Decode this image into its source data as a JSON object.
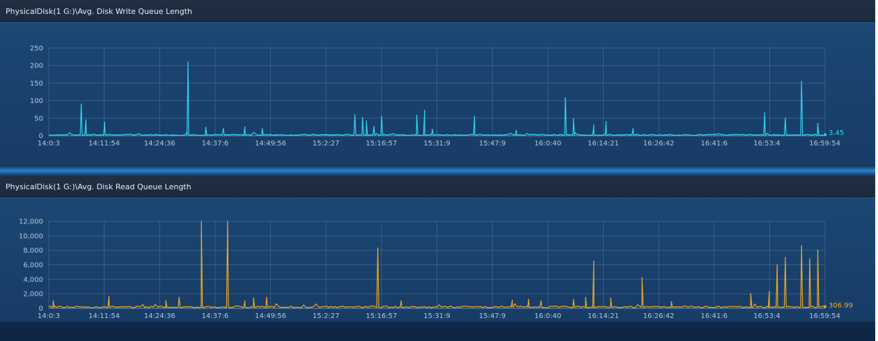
{
  "chart_data": [
    {
      "type": "line",
      "title": "PhysicalDisk(1 G:)\\Avg. Disk Write Queue Length",
      "x_tick_labels": [
        "14:0:3",
        "14:11:54",
        "14:24:36",
        "14:37:6",
        "14:49:56",
        "15:2:27",
        "15:16:57",
        "15:31:9",
        "15:47:9",
        "16:0:40",
        "16:14:21",
        "16:26:42",
        "16:41:6",
        "16:53:4",
        "16:59:54"
      ],
      "y_tick_labels": [
        "0",
        "50",
        "100",
        "150",
        "200",
        "250"
      ],
      "ylim": [
        0,
        250
      ],
      "grid": true,
      "line_color": "#2fd4f0",
      "baseline": 2,
      "current_value": "3.45",
      "peaks": [
        {
          "x": "14:07",
          "y": 90
        },
        {
          "x": "14:08",
          "y": 45
        },
        {
          "x": "14:12",
          "y": 38
        },
        {
          "x": "14:31",
          "y": 210
        },
        {
          "x": "14:35",
          "y": 24
        },
        {
          "x": "14:39",
          "y": 20
        },
        {
          "x": "14:44",
          "y": 25
        },
        {
          "x": "14:48",
          "y": 20
        },
        {
          "x": "15:10",
          "y": 60
        },
        {
          "x": "15:12",
          "y": 52
        },
        {
          "x": "15:13",
          "y": 42
        },
        {
          "x": "15:15",
          "y": 26
        },
        {
          "x": "15:17",
          "y": 55
        },
        {
          "x": "15:26",
          "y": 58
        },
        {
          "x": "15:28",
          "y": 72
        },
        {
          "x": "15:30",
          "y": 18
        },
        {
          "x": "15:42",
          "y": 56
        },
        {
          "x": "15:53",
          "y": 15
        },
        {
          "x": "16:05",
          "y": 108
        },
        {
          "x": "16:07",
          "y": 48
        },
        {
          "x": "16:12",
          "y": 30
        },
        {
          "x": "16:15",
          "y": 40
        },
        {
          "x": "16:21",
          "y": 20
        },
        {
          "x": "16:52",
          "y": 65
        },
        {
          "x": "16:55",
          "y": 50
        },
        {
          "x": "16:57",
          "y": 155
        },
        {
          "x": "16:59",
          "y": 35
        }
      ]
    },
    {
      "type": "line",
      "title": "PhysicalDisk(1 G:)\\Avg. Disk Read Queue Length",
      "x_tick_labels": [
        "14:0:3",
        "14:11:54",
        "14:24:36",
        "14:37:6",
        "14:49:56",
        "15:2:27",
        "15:16:57",
        "15:31:9",
        "15:47:9",
        "16:0:40",
        "16:14:21",
        "16:26:42",
        "16:41:6",
        "16:53:4",
        "16:59:54"
      ],
      "y_tick_labels": [
        "0",
        "2,000",
        "4,000",
        "6,000",
        "8,000",
        "10,000",
        "12,000"
      ],
      "ylim": [
        0,
        12000
      ],
      "grid": true,
      "line_color": "#f0a823",
      "baseline": 150,
      "current_value": "306.99",
      "peaks": [
        {
          "x": "14:01",
          "y": 1000
        },
        {
          "x": "14:13",
          "y": 1600
        },
        {
          "x": "14:26",
          "y": 1000
        },
        {
          "x": "14:29",
          "y": 1500
        },
        {
          "x": "14:34",
          "y": 12000
        },
        {
          "x": "14:40",
          "y": 12000
        },
        {
          "x": "14:44",
          "y": 1000
        },
        {
          "x": "14:46",
          "y": 1400
        },
        {
          "x": "14:49",
          "y": 1500
        },
        {
          "x": "15:16",
          "y": 8300
        },
        {
          "x": "15:22",
          "y": 1000
        },
        {
          "x": "15:52",
          "y": 1100
        },
        {
          "x": "15:56",
          "y": 1200
        },
        {
          "x": "15:59",
          "y": 1000
        },
        {
          "x": "16:07",
          "y": 1200
        },
        {
          "x": "16:10",
          "y": 1500
        },
        {
          "x": "16:12",
          "y": 6500
        },
        {
          "x": "16:16",
          "y": 1400
        },
        {
          "x": "16:23",
          "y": 4200
        },
        {
          "x": "16:30",
          "y": 900
        },
        {
          "x": "16:49",
          "y": 2000
        },
        {
          "x": "16:53",
          "y": 2300
        },
        {
          "x": "16:54",
          "y": 6000
        },
        {
          "x": "16:55",
          "y": 7000
        },
        {
          "x": "16:57",
          "y": 8600
        },
        {
          "x": "16:58",
          "y": 6800
        },
        {
          "x": "16:59",
          "y": 8000
        }
      ]
    }
  ]
}
